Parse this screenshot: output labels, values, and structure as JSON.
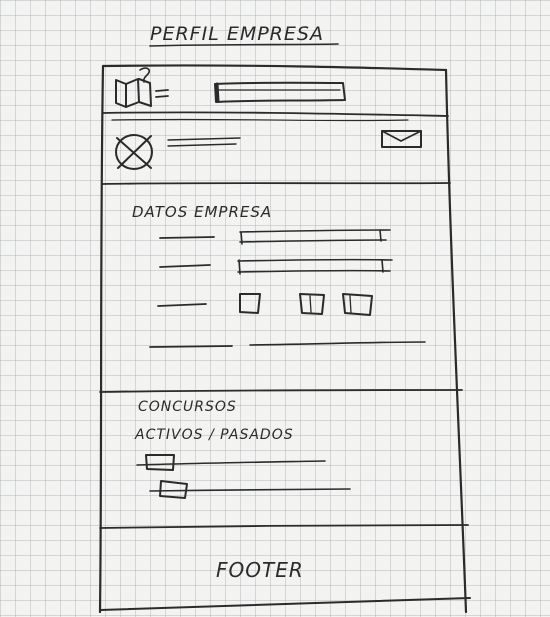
{
  "page_title": "PERFIL EMPRESA",
  "sections": {
    "company_data_heading": "DATOS EMPRESA",
    "contests_heading_line1": "CONCURSOS",
    "contests_heading_line2": "ACTIVOS / PASADOS"
  },
  "footer": {
    "label": "FOOTER"
  },
  "icons": {
    "logo": "book-logo-icon",
    "avatar": "crossed-circle-avatar-icon",
    "mail": "envelope-icon",
    "checkbox": "checkbox-icon"
  },
  "colors": {
    "ink": "#2b2b2b",
    "paper": "#f3f3f1",
    "grid": "#b4bcc4"
  }
}
